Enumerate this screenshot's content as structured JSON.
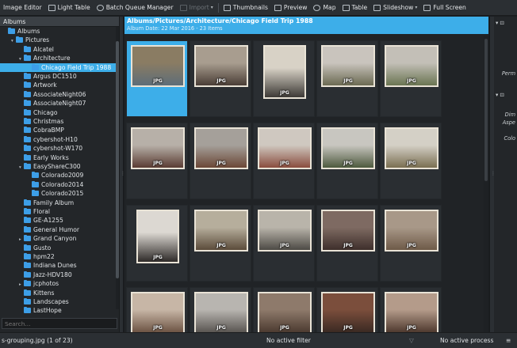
{
  "toolbar": {
    "items": [
      {
        "label": "Image Editor",
        "icon": "image-editor-icon",
        "disabled": false
      },
      {
        "label": "Light Table",
        "icon": "light-table-icon",
        "disabled": false
      },
      {
        "label": "Batch Queue Manager",
        "icon": "batch-queue-icon",
        "disabled": false
      },
      {
        "label": "Import",
        "icon": "import-icon",
        "disabled": true
      },
      {
        "label": "Thumbnails",
        "icon": "thumbnails-icon",
        "disabled": false
      },
      {
        "label": "Preview",
        "icon": "preview-icon",
        "disabled": false
      },
      {
        "label": "Map",
        "icon": "map-icon",
        "disabled": false
      },
      {
        "label": "Table",
        "icon": "table-icon",
        "disabled": false
      },
      {
        "label": "Slideshow",
        "icon": "slideshow-icon",
        "disabled": false
      },
      {
        "label": "Full Screen",
        "icon": "full-screen-icon",
        "disabled": false
      }
    ]
  },
  "left_panel": {
    "header": "Albums",
    "search_placeholder": "Search...",
    "tree": [
      {
        "label": "Albums",
        "level": 0,
        "arrow": ""
      },
      {
        "label": "Pictures",
        "level": 1,
        "arrow": "▾"
      },
      {
        "label": "Alcatel",
        "level": 2,
        "arrow": ""
      },
      {
        "label": "Architecture",
        "level": 2,
        "arrow": "▾"
      },
      {
        "label": "Chicago Field Trip 1988",
        "level": 3,
        "arrow": "",
        "selected": true
      },
      {
        "label": "Argus DC1510",
        "level": 2,
        "arrow": ""
      },
      {
        "label": "Artwork",
        "level": 2,
        "arrow": ""
      },
      {
        "label": "AssociateNight06",
        "level": 2,
        "arrow": ""
      },
      {
        "label": "AssociateNight07",
        "level": 2,
        "arrow": ""
      },
      {
        "label": "Chicago",
        "level": 2,
        "arrow": ""
      },
      {
        "label": "Christmas",
        "level": 2,
        "arrow": ""
      },
      {
        "label": "CobraBMP",
        "level": 2,
        "arrow": ""
      },
      {
        "label": "cybershot-H10",
        "level": 2,
        "arrow": ""
      },
      {
        "label": "cybershot-W170",
        "level": 2,
        "arrow": ""
      },
      {
        "label": "Early Works",
        "level": 2,
        "arrow": ""
      },
      {
        "label": "EasyShareC300",
        "level": 2,
        "arrow": "▾"
      },
      {
        "label": "Colorado2009",
        "level": 3,
        "arrow": ""
      },
      {
        "label": "Colorado2014",
        "level": 3,
        "arrow": ""
      },
      {
        "label": "Colorado2015",
        "level": 3,
        "arrow": ""
      },
      {
        "label": "Family Album",
        "level": 2,
        "arrow": ""
      },
      {
        "label": "Floral",
        "level": 2,
        "arrow": ""
      },
      {
        "label": "GE-A1255",
        "level": 2,
        "arrow": ""
      },
      {
        "label": "General Humor",
        "level": 2,
        "arrow": ""
      },
      {
        "label": "Grand Canyon",
        "level": 2,
        "arrow": "▸"
      },
      {
        "label": "Gusto",
        "level": 2,
        "arrow": ""
      },
      {
        "label": "hpm22",
        "level": 2,
        "arrow": ""
      },
      {
        "label": "Indiana Dunes",
        "level": 2,
        "arrow": ""
      },
      {
        "label": "Jazz-HDV180",
        "level": 2,
        "arrow": ""
      },
      {
        "label": "jcphotos",
        "level": 2,
        "arrow": "▸"
      },
      {
        "label": "Kittens",
        "level": 2,
        "arrow": ""
      },
      {
        "label": "Landscapes",
        "level": 2,
        "arrow": ""
      },
      {
        "label": "LastHope",
        "level": 2,
        "arrow": ""
      }
    ]
  },
  "main": {
    "title": "Albums/Pictures/Architecture/Chicago Field Trip 1988",
    "subtitle": "Album Date: 22 Mar 2016 - 23 Items",
    "thumbnails": [
      {
        "badge": "JPG",
        "colors": [
          "#8a7c63",
          "#5e6d78"
        ],
        "selected": true,
        "tall": false
      },
      {
        "badge": "JPG",
        "colors": [
          "#a89d8f",
          "#4a3e36"
        ],
        "selected": false,
        "tall": false
      },
      {
        "badge": "JPG",
        "colors": [
          "#d8d2c6",
          "#3d3a36"
        ],
        "selected": false,
        "tall": true
      },
      {
        "badge": "JPG",
        "colors": [
          "#c9c4bd",
          "#6b6a52"
        ],
        "selected": false,
        "tall": false
      },
      {
        "badge": "JPG",
        "colors": [
          "#c3bfb7",
          "#6a7552"
        ],
        "selected": false,
        "tall": false
      },
      {
        "badge": "JPG",
        "colors": [
          "#b7b0a8",
          "#5a3c33"
        ],
        "selected": false,
        "tall": false
      },
      {
        "badge": "JPG",
        "colors": [
          "#a5a09a",
          "#6b4736"
        ],
        "selected": false,
        "tall": false
      },
      {
        "badge": "JPG",
        "colors": [
          "#cfc8c0",
          "#8a4d3e"
        ],
        "selected": false,
        "tall": false
      },
      {
        "badge": "JPG",
        "colors": [
          "#c8c6c0",
          "#4e5a3e"
        ],
        "selected": false,
        "tall": false
      },
      {
        "badge": "JPG",
        "colors": [
          "#d4d0c6",
          "#7a6f52"
        ],
        "selected": false,
        "tall": false
      },
      {
        "badge": "JPG",
        "colors": [
          "#dcd8d2",
          "#2e2a28"
        ],
        "selected": false,
        "tall": true
      },
      {
        "badge": "JPG",
        "colors": [
          "#b6ae9c",
          "#5b4b3a"
        ],
        "selected": false,
        "tall": false
      },
      {
        "badge": "JPG",
        "colors": [
          "#b9b4aa",
          "#4d4a45"
        ],
        "selected": false,
        "tall": false
      },
      {
        "badge": "JPG",
        "colors": [
          "#7e6a62",
          "#3e2f2b"
        ],
        "selected": false,
        "tall": false
      },
      {
        "badge": "JPG",
        "colors": [
          "#a89888",
          "#6e5a48"
        ],
        "selected": false,
        "tall": false
      },
      {
        "badge": "JPG",
        "colors": [
          "#c7b6a6",
          "#6d5444"
        ],
        "selected": false,
        "tall": false
      },
      {
        "badge": "JPG",
        "colors": [
          "#b8b5b0",
          "#5a5652"
        ],
        "selected": false,
        "tall": false
      },
      {
        "badge": "JPG",
        "colors": [
          "#8e7a6b",
          "#4c3b31"
        ],
        "selected": false,
        "tall": false
      },
      {
        "badge": "JPG",
        "colors": [
          "#7b4e3c",
          "#3b2a23"
        ],
        "selected": false,
        "tall": false
      },
      {
        "badge": "JPG",
        "colors": [
          "#b49b8a",
          "#4f3a2f"
        ],
        "selected": false,
        "tall": false
      }
    ]
  },
  "right_panel": {
    "lines": [
      "▾ ⊡",
      "Perm",
      "▾ ⊡",
      "Dim",
      "Aspe",
      "Colo"
    ]
  },
  "status": {
    "filename": "s-grouping.jpg (1 of 23)",
    "filter": "No active filter",
    "process": "No active process"
  }
}
